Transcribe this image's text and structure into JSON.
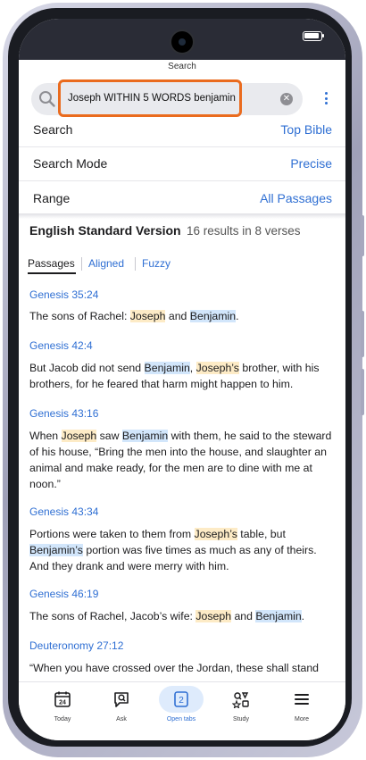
{
  "screen": {
    "title": "Search"
  },
  "search": {
    "query": "Joseph WITHIN 5 WORDS benjamin"
  },
  "settings": [
    {
      "label": "Search",
      "value": "Top Bible"
    },
    {
      "label": "Search Mode",
      "value": "Precise"
    },
    {
      "label": "Range",
      "value": "All Passages"
    }
  ],
  "results": {
    "version": "English Standard Version",
    "count": "16 results in 8 verses",
    "tabs": [
      "Passages",
      "Aligned",
      "Fuzzy"
    ],
    "active_tab": "Passages"
  },
  "verses": [
    {
      "ref": "Genesis 35:24",
      "segments": [
        {
          "t": "The sons of Rachel: "
        },
        {
          "t": "Joseph",
          "hl": "j"
        },
        {
          "t": " and "
        },
        {
          "t": "Benjamin",
          "hl": "b"
        },
        {
          "t": "."
        }
      ]
    },
    {
      "ref": "Genesis 42:4",
      "segments": [
        {
          "t": "But Jacob did not send "
        },
        {
          "t": "Benjamin",
          "hl": "b"
        },
        {
          "t": ", "
        },
        {
          "t": "Joseph’s",
          "hl": "j"
        },
        {
          "t": " brother, with his brothers, for he feared that harm might happen to him."
        }
      ]
    },
    {
      "ref": "Genesis 43:16",
      "segments": [
        {
          "t": "When "
        },
        {
          "t": "Joseph",
          "hl": "j"
        },
        {
          "t": " saw "
        },
        {
          "t": "Benjamin",
          "hl": "b"
        },
        {
          "t": " with them, he said to the steward of his house, “Bring the men into the house, and slaughter an animal and make ready, for the men are to dine with me at noon.”"
        }
      ]
    },
    {
      "ref": "Genesis 43:34",
      "segments": [
        {
          "t": "Portions were taken to them from "
        },
        {
          "t": "Joseph’s",
          "hl": "j"
        },
        {
          "t": " table, but "
        },
        {
          "t": "Benjamin’s",
          "hl": "b"
        },
        {
          "t": " portion was five times as much as any of theirs. And they drank and were merry with him."
        }
      ]
    },
    {
      "ref": "Genesis 46:19",
      "segments": [
        {
          "t": "The sons of Rachel, Jacob’s wife: "
        },
        {
          "t": "Joseph",
          "hl": "j"
        },
        {
          "t": " and "
        },
        {
          "t": "Benjamin",
          "hl": "b"
        },
        {
          "t": "."
        }
      ]
    },
    {
      "ref": "Deuteronomy 27:12",
      "segments": [
        {
          "t": "“When you have crossed over the Jordan, these shall stand"
        }
      ]
    }
  ],
  "tabbar": {
    "items": [
      {
        "label": "Today",
        "icon": "calendar-icon",
        "badge": "24"
      },
      {
        "label": "Ask",
        "icon": "chat-search-icon"
      },
      {
        "label": "Open tabs",
        "icon": "tabs-icon",
        "badge": "2"
      },
      {
        "label": "Study",
        "icon": "study-icon"
      },
      {
        "label": "More",
        "icon": "menu-icon"
      }
    ],
    "active": "Open tabs",
    "accent": "#2f6fd3"
  },
  "colors": {
    "accent": "#2f6fd3",
    "highlight_query_box": "#ea6b1e",
    "highlight_joseph": "#fdebc6",
    "highlight_benjamin": "#d2e6fb"
  }
}
